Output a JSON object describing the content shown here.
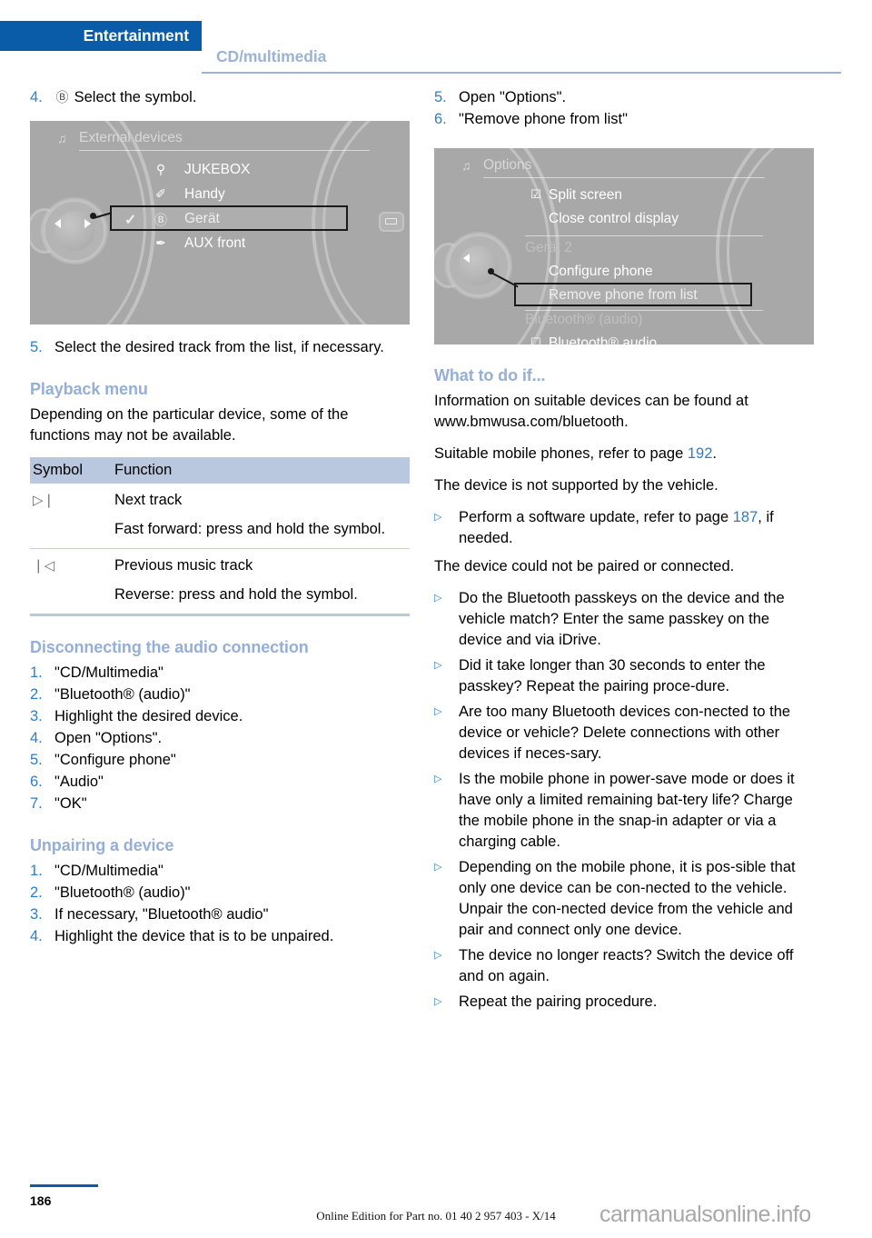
{
  "header": {
    "active_tab": "Entertainment",
    "inactive_tab": "CD/multimedia",
    "active_bg": "#0a5ca8",
    "inactive_color": "#9bb3d6"
  },
  "left_column": {
    "step4": {
      "num": "4.",
      "symbol": "bluetooth-icon",
      "symbol_glyph": "Ⓑ",
      "text": "Select the symbol."
    },
    "screenshot1": {
      "title": "External devices",
      "title_icon": "multimedia-note-icon",
      "items": [
        {
          "label": "JUKEBOX",
          "icon_glyph": "⚲",
          "icon_name": "usb-icon",
          "checked": false,
          "highlighted": false
        },
        {
          "label": "Handy",
          "icon_glyph": "✐",
          "icon_name": "phone-icon",
          "checked": false,
          "highlighted": false
        },
        {
          "label": "Gerät",
          "icon_glyph": "Ⓑ",
          "icon_name": "bluetooth-icon",
          "checked": true,
          "highlighted": true
        },
        {
          "label": "AUX front",
          "icon_glyph": "✒",
          "icon_name": "aux-jack-icon",
          "checked": false,
          "highlighted": false
        }
      ]
    },
    "step5": {
      "num": "5.",
      "text": "Select the desired track from the list, if necessary."
    },
    "playback_heading": "Playback menu",
    "playback_intro": "Depending on the particular device, some of the functions may not be available.",
    "table": {
      "headers": [
        "Symbol",
        "Function"
      ],
      "rows": [
        {
          "symbol_glyph": "▷❘",
          "symbol_name": "next-track-icon",
          "lines": [
            "Next track",
            "Fast forward: press and hold the symbol."
          ]
        },
        {
          "symbol_glyph": "❘◁",
          "symbol_name": "previous-track-icon",
          "lines": [
            "Previous music track",
            "Reverse: press and hold the symbol."
          ]
        }
      ]
    },
    "disconnect_heading": "Disconnecting the audio connection",
    "disconnect_steps": [
      {
        "num": "1.",
        "text": "\"CD/Multimedia\""
      },
      {
        "num": "2.",
        "text": "\"Bluetooth® (audio)\""
      },
      {
        "num": "3.",
        "text": "Highlight the desired device."
      },
      {
        "num": "4.",
        "text": "Open \"Options\"."
      },
      {
        "num": "5.",
        "text": "\"Configure phone\""
      },
      {
        "num": "6.",
        "text": "\"Audio\""
      },
      {
        "num": "7.",
        "text": "\"OK\""
      }
    ],
    "unpair_heading": "Unpairing a device",
    "unpair_steps": [
      {
        "num": "1.",
        "text": "\"CD/Multimedia\""
      },
      {
        "num": "2.",
        "text": "\"Bluetooth® (audio)\""
      },
      {
        "num": "3.",
        "text": "If necessary, \"Bluetooth® audio\""
      },
      {
        "num": "4.",
        "text": "Highlight the device that is to be unpaired."
      }
    ]
  },
  "right_column": {
    "steps_top": [
      {
        "num": "5.",
        "text": "Open \"Options\"."
      },
      {
        "num": "6.",
        "text": "\"Remove phone from list\""
      }
    ],
    "screenshot2": {
      "title": "Options",
      "title_icon": "multimedia-note-icon",
      "items": [
        {
          "label": "Split screen",
          "checkbox": "checked",
          "dim": false,
          "highlighted": false
        },
        {
          "label": "Close control display",
          "checkbox": "none",
          "dim": false,
          "highlighted": false
        },
        {
          "label": "Gerät 2",
          "checkbox": "none",
          "dim": true,
          "highlighted": false
        },
        {
          "label": "Configure phone",
          "checkbox": "none",
          "dim": false,
          "highlighted": false
        },
        {
          "label": "Remove phone from list",
          "checkbox": "none",
          "dim": false,
          "highlighted": true
        },
        {
          "label": "Bluetooth® (audio)",
          "checkbox": "none",
          "dim": true,
          "highlighted": false
        },
        {
          "label": "Bluetooth® audio",
          "checkbox": "unchecked",
          "dim": false,
          "highlighted": false
        }
      ]
    },
    "what_heading": "What to do if...",
    "para1": "Information on suitable devices can be found at www.bmwusa.com/bluetooth.",
    "para2_pre": "Suitable mobile phones, refer to page ",
    "para2_ref": "192",
    "para2_post": ".",
    "para3": "The device is not supported by the vehicle.",
    "bullet1_pre": "Perform a software update, refer to page ",
    "bullet1_ref": "187",
    "bullet1_post": ", if needed.",
    "para4": "The device could not be paired or connected.",
    "bullets": [
      "Do the Bluetooth passkeys on the device and the vehicle match? Enter the same passkey on the device and via iDrive.",
      "Did it take longer than 30 seconds to enter the passkey? Repeat the pairing proce-dure.",
      "Are too many Bluetooth devices con-nected to the device or vehicle? Delete connections with other devices if neces-sary.",
      "Is the mobile phone in power-save mode or does it have only a limited remaining bat-tery life? Charge the mobile phone in the snap-in adapter or via a charging cable.",
      "Depending on the mobile phone, it is pos-sible that only one device can be con-nected to the vehicle. Unpair the con-nected device from the vehicle and pair and connect only one device.",
      "The device no longer reacts? Switch the device off and on again.",
      "Repeat the pairing procedure."
    ]
  },
  "footer": {
    "page_number": "186",
    "center_text": "Online Edition for Part no. 01 40 2 957 403 - X/14",
    "watermark": "carmanualsonline.info"
  }
}
